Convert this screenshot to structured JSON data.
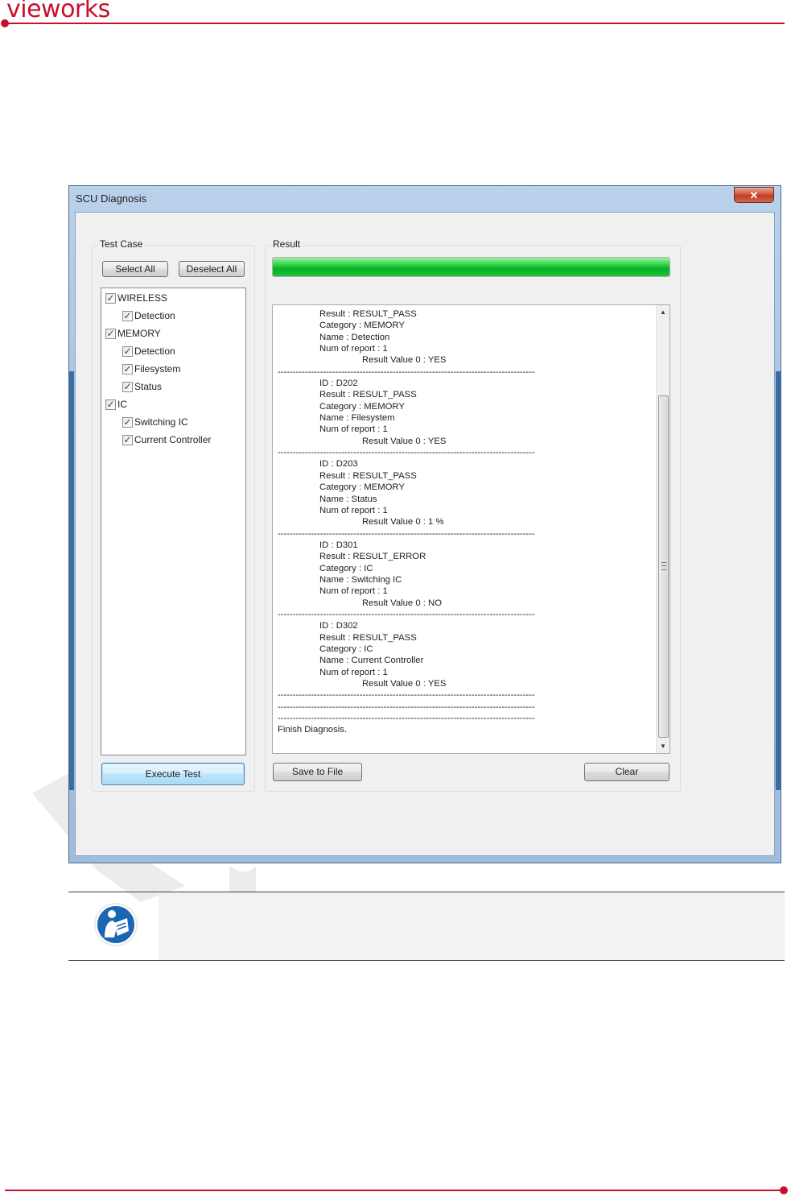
{
  "brand": {
    "logo_text": "vieworks"
  },
  "window": {
    "title": "SCU Diagnosis",
    "close_glyph": "✕"
  },
  "test_case": {
    "group_label": "Test Case",
    "select_all": "Select All",
    "deselect_all": "Deselect All",
    "tree": [
      {
        "label": "WIRELESS",
        "checked": true,
        "level": 0
      },
      {
        "label": "Detection",
        "checked": true,
        "level": 1
      },
      {
        "label": "MEMORY",
        "checked": true,
        "level": 0
      },
      {
        "label": "Detection",
        "checked": true,
        "level": 1
      },
      {
        "label": "Filesystem",
        "checked": true,
        "level": 1
      },
      {
        "label": "Status",
        "checked": true,
        "level": 1
      },
      {
        "label": "IC",
        "checked": true,
        "level": 0
      },
      {
        "label": "Switching IC",
        "checked": true,
        "level": 1
      },
      {
        "label": "Current Controller",
        "checked": true,
        "level": 1
      }
    ],
    "execute": "Execute Test"
  },
  "result": {
    "group_label": "Result",
    "progress": 1.0,
    "lines": [
      {
        "text": "Result : RESULT_PASS",
        "indent": 1
      },
      {
        "text": "Category : MEMORY",
        "indent": 1
      },
      {
        "text": "Name : Detection",
        "indent": 1
      },
      {
        "text": "Num of report : 1",
        "indent": 1
      },
      {
        "text": "Result Value 0 : YES",
        "indent": 2
      },
      {
        "text": "-------------------------------------------------------------------------------------",
        "indent": 0
      },
      {
        "text": "ID : D202",
        "indent": 1
      },
      {
        "text": "Result : RESULT_PASS",
        "indent": 1
      },
      {
        "text": "Category : MEMORY",
        "indent": 1
      },
      {
        "text": "Name : Filesystem",
        "indent": 1
      },
      {
        "text": "Num of report : 1",
        "indent": 1
      },
      {
        "text": "Result Value 0 : YES",
        "indent": 2
      },
      {
        "text": "-------------------------------------------------------------------------------------",
        "indent": 0
      },
      {
        "text": "ID : D203",
        "indent": 1
      },
      {
        "text": "Result : RESULT_PASS",
        "indent": 1
      },
      {
        "text": "Category : MEMORY",
        "indent": 1
      },
      {
        "text": "Name : Status",
        "indent": 1
      },
      {
        "text": "Num of report : 1",
        "indent": 1
      },
      {
        "text": "Result Value 0 : 1 %",
        "indent": 2
      },
      {
        "text": "-------------------------------------------------------------------------------------",
        "indent": 0
      },
      {
        "text": "ID : D301",
        "indent": 1
      },
      {
        "text": "Result : RESULT_ERROR",
        "indent": 1
      },
      {
        "text": "Category : IC",
        "indent": 1
      },
      {
        "text": "Name : Switching IC",
        "indent": 1
      },
      {
        "text": "Num of report : 1",
        "indent": 1
      },
      {
        "text": "Result Value 0 : NO",
        "indent": 2
      },
      {
        "text": "-------------------------------------------------------------------------------------",
        "indent": 0
      },
      {
        "text": "ID : D302",
        "indent": 1
      },
      {
        "text": "Result : RESULT_PASS",
        "indent": 1
      },
      {
        "text": "Category : IC",
        "indent": 1
      },
      {
        "text": "Name : Current Controller",
        "indent": 1
      },
      {
        "text": "Num of report : 1",
        "indent": 1
      },
      {
        "text": "Result Value 0 : YES",
        "indent": 2
      },
      {
        "text": "-------------------------------------------------------------------------------------",
        "indent": 0
      },
      {
        "text": "-------------------------------------------------------------------------------------",
        "indent": 0
      },
      {
        "text": "-------------------------------------------------------------------------------------",
        "indent": 0
      },
      {
        "text": "Finish Diagnosis.",
        "indent": 0
      }
    ],
    "save": "Save to File",
    "clear": "Clear",
    "scroll_up_glyph": "▲",
    "scroll_down_glyph": "▼"
  },
  "colors": {
    "brand_red": "#c8102e",
    "progress_green": "#06b025",
    "window_frame": "#a8c3e0"
  },
  "icons": [
    "close-icon",
    "checkbox-checked-icon",
    "scroll-up-icon",
    "scroll-down-icon",
    "scroll-grip-icon",
    "manual-reading-icon"
  ]
}
